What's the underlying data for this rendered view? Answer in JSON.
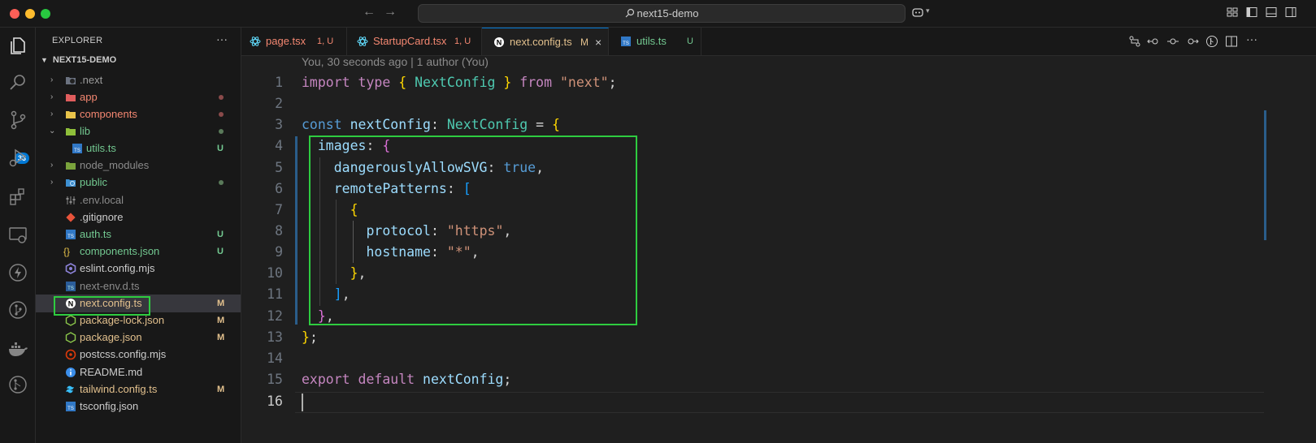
{
  "window": {
    "title": "next15-demo"
  },
  "activity_bar": {
    "badge": "33"
  },
  "explorer": {
    "title": "EXPLORER",
    "more": "···",
    "root": "NEXT15-DEMO",
    "items": [
      {
        "name": ".next",
        "status": ""
      },
      {
        "name": "app",
        "status": ""
      },
      {
        "name": "components",
        "status": ""
      },
      {
        "name": "lib",
        "status": ""
      },
      {
        "name": "utils.ts",
        "status": "U"
      },
      {
        "name": "node_modules",
        "status": ""
      },
      {
        "name": "public",
        "status": ""
      },
      {
        "name": ".env.local",
        "status": ""
      },
      {
        "name": ".gitignore",
        "status": ""
      },
      {
        "name": "auth.ts",
        "status": "U"
      },
      {
        "name": "components.json",
        "status": "U"
      },
      {
        "name": "eslint.config.mjs",
        "status": ""
      },
      {
        "name": "next-env.d.ts",
        "status": ""
      },
      {
        "name": "next.config.ts",
        "status": "M"
      },
      {
        "name": "package-lock.json",
        "status": "M"
      },
      {
        "name": "package.json",
        "status": "M"
      },
      {
        "name": "postcss.config.mjs",
        "status": ""
      },
      {
        "name": "README.md",
        "status": ""
      },
      {
        "name": "tailwind.config.ts",
        "status": "M"
      },
      {
        "name": "tsconfig.json",
        "status": ""
      }
    ]
  },
  "tabs": [
    {
      "label": "page.tsx",
      "status": "1, U"
    },
    {
      "label": "StartupCard.tsx",
      "status": "1, U"
    },
    {
      "label": "next.config.ts",
      "status": "M"
    },
    {
      "label": "utils.ts",
      "status": "U"
    }
  ],
  "editor": {
    "blame": "You, 30 seconds ago | 1 author (You)",
    "line_numbers": [
      "1",
      "2",
      "3",
      "4",
      "5",
      "6",
      "7",
      "8",
      "9",
      "10",
      "11",
      "12",
      "13",
      "14",
      "15",
      "16"
    ],
    "code": {
      "l1_import": "import",
      "l1_type": "type",
      "l1_ob": "{",
      "l1_name": "NextConfig",
      "l1_cb": "}",
      "l1_from": "from",
      "l1_str": "\"next\"",
      "l1_semi": ";",
      "l3_const": "const",
      "l3_var": "nextConfig",
      "l3_colon": ":",
      "l3_type": "NextConfig",
      "l3_eq": "=",
      "l3_ob": "{",
      "l4_key": "images",
      "l4_colon": ":",
      "l4_ob": "{",
      "l5_key": "dangerouslyAllowSVG",
      "l5_colon": ":",
      "l5_val": "true",
      "l5_comma": ",",
      "l6_key": "remotePatterns",
      "l6_colon": ":",
      "l6_ob": "[",
      "l7_ob": "{",
      "l8_key": "protocol",
      "l8_colon": ":",
      "l8_val": "\"https\"",
      "l8_comma": ",",
      "l9_key": "hostname",
      "l9_colon": ":",
      "l9_val": "\"*\"",
      "l9_comma": ",",
      "l10_cb": "}",
      "l10_comma": ",",
      "l11_cb": "]",
      "l11_comma": ",",
      "l12_cb": "}",
      "l12_comma": ",",
      "l13_cb": "}",
      "l13_semi": ";",
      "l15_export": "export",
      "l15_default": "default",
      "l15_var": "nextConfig",
      "l15_semi": ";"
    }
  }
}
